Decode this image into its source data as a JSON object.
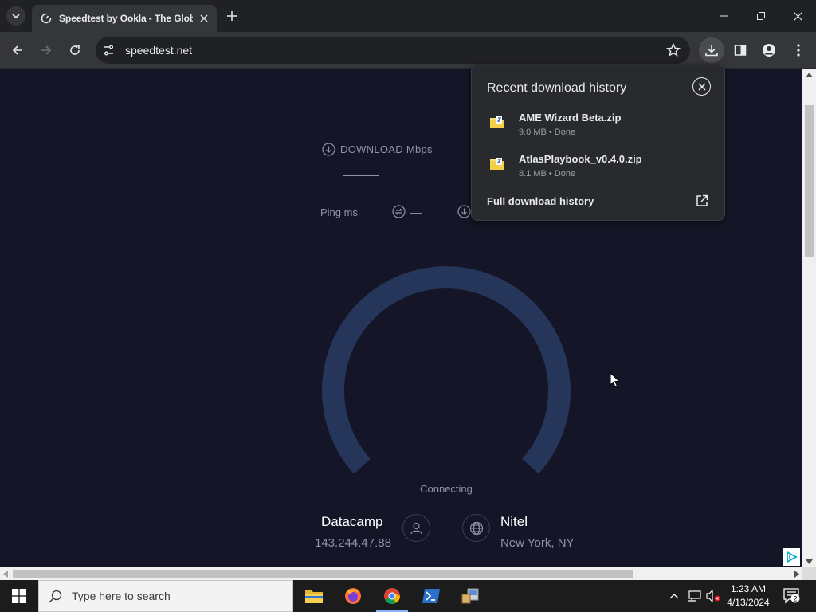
{
  "browser": {
    "tab_title": "Speedtest by Ookla - The Glob",
    "url": "speedtest.net"
  },
  "speedtest": {
    "download_label": "DOWNLOAD Mbps",
    "ping_label": "Ping ms",
    "ping_download_value": "—",
    "status": "Connecting",
    "isp_name": "Datacamp",
    "isp_ip": "143.244.47.88",
    "server_name": "Nitel",
    "server_location": "New York, NY",
    "gauge_color": "#26365a"
  },
  "download_popup": {
    "title": "Recent download history",
    "items": [
      {
        "name": "AME Wizard Beta.zip",
        "meta": "9.0 MB • Done"
      },
      {
        "name": "AtlasPlaybook_v0.4.0.zip",
        "meta": "8.1 MB • Done"
      }
    ],
    "full_history_label": "Full download history"
  },
  "taskbar": {
    "search_placeholder": "Type here to search",
    "time": "1:23 AM",
    "date": "4/13/2024",
    "notification_count": "2"
  }
}
